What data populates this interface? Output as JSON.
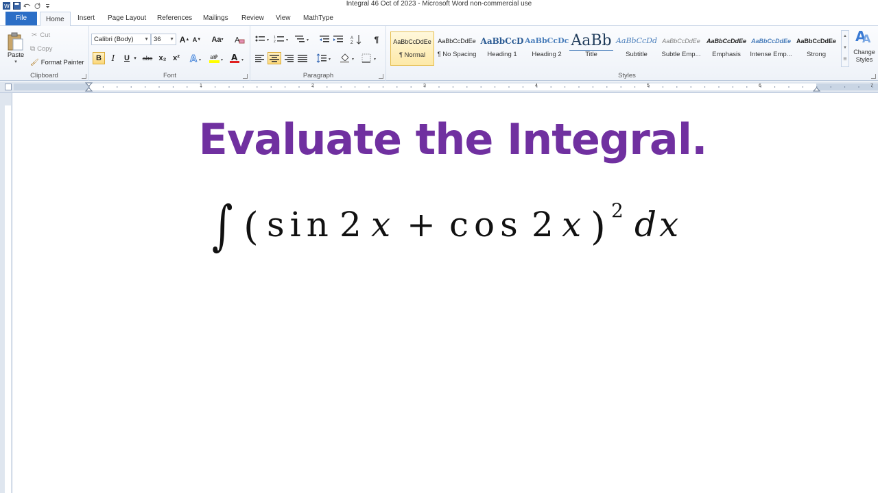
{
  "window": {
    "title": "Integral 46 Oct of 2023  -  Microsoft Word non-commercial use"
  },
  "tabs": {
    "file": "File",
    "items": [
      "Home",
      "Insert",
      "Page Layout",
      "References",
      "Mailings",
      "Review",
      "View",
      "MathType"
    ],
    "active": "Home"
  },
  "clipboard": {
    "paste": "Paste",
    "cut": "Cut",
    "copy": "Copy",
    "format_painter": "Format Painter",
    "label": "Clipboard"
  },
  "font": {
    "name": "Calibri (Body)",
    "size": "36",
    "label": "Font",
    "bold": "B",
    "italic": "I",
    "underline": "U",
    "strike": "abc",
    "subscript": "x₂",
    "superscript": "x²",
    "grow": "A",
    "shrink": "A",
    "change_case": "Aa"
  },
  "paragraph": {
    "label": "Paragraph"
  },
  "styles": {
    "label": "Styles",
    "items": [
      {
        "sample": "AaBbCcDdEe",
        "name": "¶ Normal"
      },
      {
        "sample": "AaBbCcDdEe",
        "name": "¶ No Spacing"
      },
      {
        "sample": "AaBbCcD",
        "name": "Heading 1"
      },
      {
        "sample": "AaBbCcDc",
        "name": "Heading 2"
      },
      {
        "sample": "AaBb",
        "name": "Title"
      },
      {
        "sample": "AaBbCcDd",
        "name": "Subtitle"
      },
      {
        "sample": "AaBbCcDdEe",
        "name": "Subtle Emp..."
      },
      {
        "sample": "AaBbCcDdEe",
        "name": "Emphasis"
      },
      {
        "sample": "AaBbCcDdEe",
        "name": "Intense Emp..."
      },
      {
        "sample": "AaBbCcDdEe",
        "name": "Strong"
      }
    ],
    "change_styles": "Change Styles"
  },
  "ruler": {
    "numbers": [
      "1",
      "2",
      "3",
      "4",
      "5",
      "6",
      "7"
    ]
  },
  "document": {
    "heading": "Evaluate the Integral.",
    "equation": {
      "integral": "∫",
      "open": "(",
      "sin": "sin",
      "two_a": "2",
      "x_a": "x",
      "plus": "+",
      "cos": "cos",
      "two_b": "2",
      "x_b": "x",
      "close": ")",
      "exponent": "2",
      "d": "d",
      "x_c": "x"
    }
  },
  "colors": {
    "heading": "#7030a0",
    "file_tab": "#2b6ec6",
    "selected_style": "#fde9a8"
  }
}
